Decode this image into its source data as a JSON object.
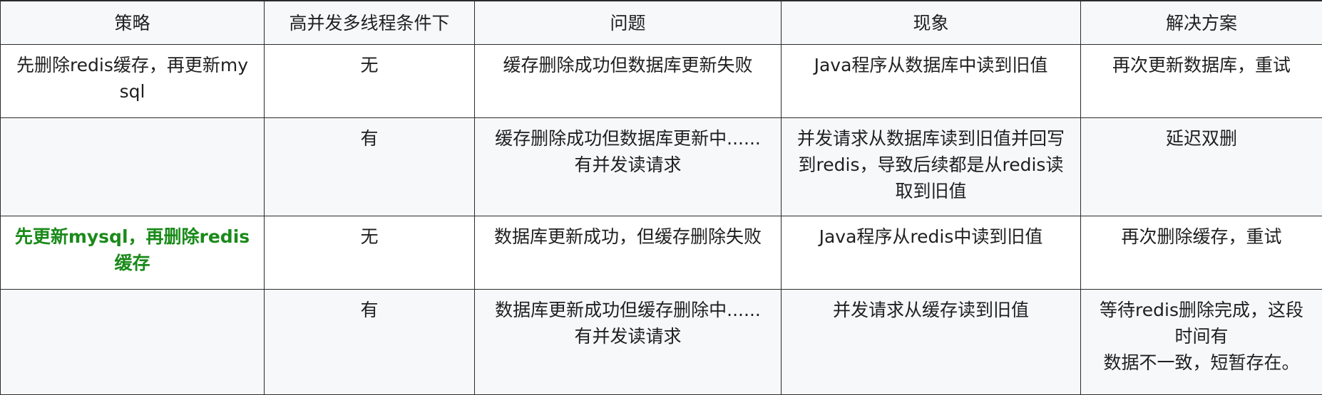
{
  "table": {
    "headers": [
      "策略",
      "高并发多线程条件下",
      "问题",
      "现象",
      "解决方案"
    ],
    "rows": [
      {
        "strategy": "先删除redis缓存，再更新mysql",
        "concurrency": "无",
        "problem": "缓存删除成功但数据库更新失败",
        "phenomenon": "Java程序从数据库中读到旧值",
        "solution": "再次更新数据库，重试"
      },
      {
        "strategy": "",
        "concurrency": "有",
        "problem": "缓存删除成功但数据库更新中......有并发读请求",
        "phenomenon": "并发请求从数据库读到旧值并回写到redis，导致后续都是从redis读取到旧值",
        "solution": "延迟双删"
      },
      {
        "strategy": "先更新mysql，再删除redis缓存",
        "concurrency": "无",
        "problem": "数据库更新成功，但缓存删除失败",
        "phenomenon": "Java程序从redis中读到旧值",
        "solution": "再次删除缓存，重试"
      },
      {
        "strategy": "",
        "concurrency": "有",
        "problem": "数据库更新成功但缓存删除中......有并发读请求",
        "phenomenon": "并发请求从缓存读到旧值",
        "solution_lines": [
          "等待redis删除完成，这段时间有",
          "数据不一致，短暂存在。"
        ]
      }
    ],
    "highlight_color": "#1a8a1a"
  }
}
